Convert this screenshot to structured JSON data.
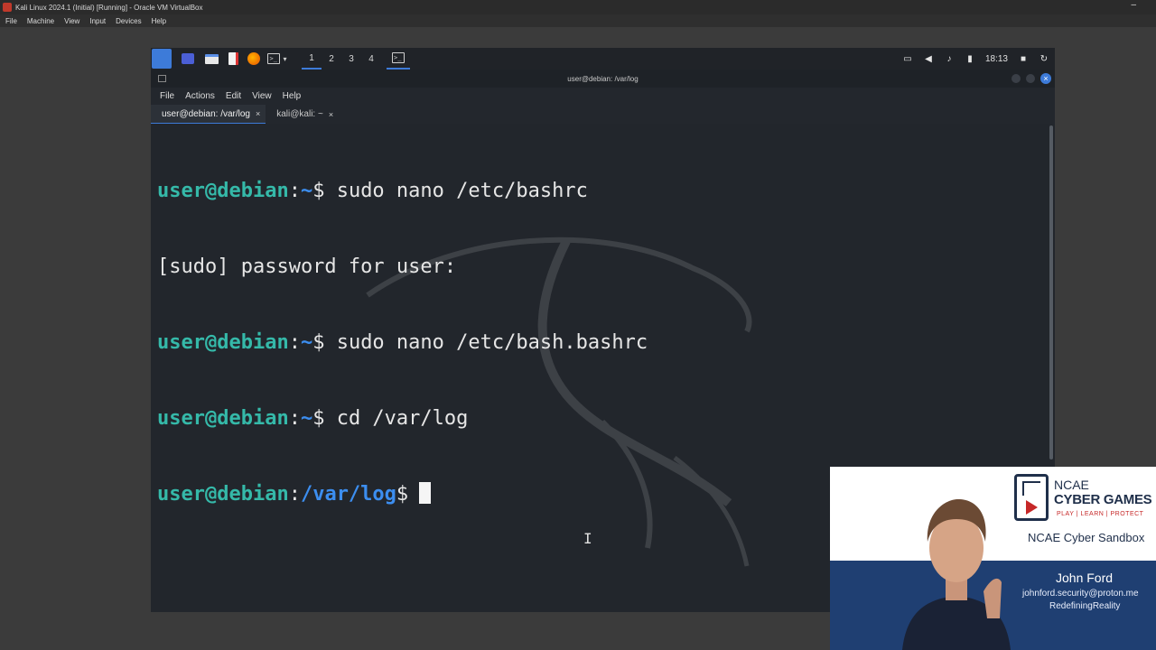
{
  "host": {
    "window_title": "Kali Linux 2024.1 (Initial) [Running] - Oracle VM VirtualBox",
    "minimize_glyph": "–",
    "menu": [
      "File",
      "Machine",
      "View",
      "Input",
      "Devices",
      "Help"
    ]
  },
  "guest_panel": {
    "workspaces": [
      "1",
      "2",
      "3",
      "4"
    ],
    "active_workspace": "1",
    "terminal_glyph": ">_",
    "clock": "18:13",
    "icons": [
      "kali-menu-icon",
      "app-icon",
      "file-manager-icon",
      "text-editor-icon",
      "firefox-icon",
      "terminal-icon",
      "display-icon",
      "volume-icon",
      "bell-icon",
      "battery-icon",
      "lock-icon",
      "power-icon"
    ]
  },
  "terminal": {
    "window_title": "user@debian: /var/log",
    "close_glyph": "×",
    "menu": [
      "File",
      "Actions",
      "Edit",
      "View",
      "Help"
    ],
    "tabs": [
      {
        "label": "user@debian: /var/log",
        "close": "×"
      },
      {
        "label": "kali@kali: ~",
        "close": "×"
      }
    ],
    "lines": [
      {
        "user": "user@debian",
        "sep": ":",
        "path": "~",
        "sign": "$",
        "cmd": " sudo nano /etc/bashrc"
      },
      {
        "text": "[sudo] password for user:"
      },
      {
        "user": "user@debian",
        "sep": ":",
        "path": "~",
        "sign": "$",
        "cmd": " sudo nano /etc/bash.bashrc"
      },
      {
        "user": "user@debian",
        "sep": ":",
        "path": "~",
        "sign": "$",
        "cmd": " cd /var/log"
      },
      {
        "user": "user@debian",
        "sep": ":",
        "path": "/var/log",
        "sign": "$",
        "cmd": ""
      }
    ],
    "ibeam_glyph": "I"
  },
  "overlay": {
    "logo_line1": "NCAE",
    "logo_line2": "CYBER GAMES",
    "logo_tagline": "PLAY | LEARN | PROTECT",
    "sandbox": "NCAE Cyber Sandbox",
    "name": "John Ford",
    "email": "johnford.security@proton.me",
    "handle": "RedefiningReality"
  },
  "colors": {
    "prompt_user": "#35b9a9",
    "prompt_path": "#3c8ef0",
    "accent": "#3d7bd9",
    "overlay_band": "#1f3f72"
  }
}
